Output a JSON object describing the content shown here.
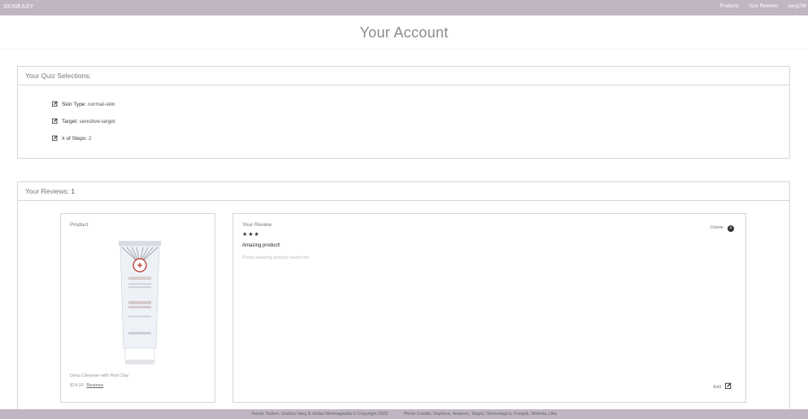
{
  "nav": {
    "brand": "SKINEASY",
    "links": [
      "Products",
      "Your Reviews",
      "sang798"
    ]
  },
  "page": {
    "title": "Your Account"
  },
  "quiz": {
    "heading": "Your Quiz Selections:",
    "rows": [
      {
        "key": "Skin Type:",
        "value": "normal-skin"
      },
      {
        "key": "Target:",
        "value": "sensitive-target"
      },
      {
        "key": "# of Steps:",
        "value": "2"
      }
    ]
  },
  "reviews": {
    "heading": "Your Reviews:",
    "count": "1",
    "product_label": "Product",
    "product": {
      "name": "Deep Cleanser with Red Clay",
      "price": "$24.00",
      "reviews_link": "Reviews"
    },
    "review_label": "Your Review",
    "rating": 3,
    "stars": "★★★",
    "title": "Amazing product!",
    "body": "Pretty amazing product saved me",
    "delete_label": "Delete",
    "edit_label": "Edit"
  },
  "footer": {
    "copyright": "Tenzin Tsoten, Joshua Yang & Ishika Nimmagadda © Copyright 2023",
    "credits": "Photo Credits: Sephora, Amazon, Target, Dermalogica, Freepik, Weleda, Ulta"
  },
  "colors": {
    "nav_bg": "#c0b5c2",
    "border": "#d7d7d7"
  }
}
